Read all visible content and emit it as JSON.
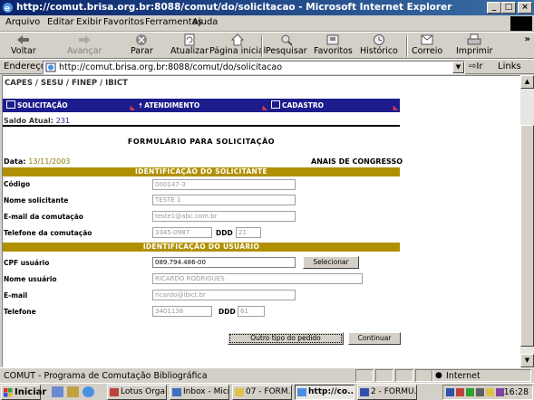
{
  "window": {
    "title": "http://comut.brisa.org.br:8088/comut/do/solicitacao - Microsoft Internet Explorer",
    "controls": [
      "_",
      "□",
      "×"
    ]
  },
  "menu": [
    "Arquivo",
    "Editar",
    "Exibir",
    "Favoritos",
    "Ferramentas",
    "Ajuda"
  ],
  "toolbar": {
    "back": "Voltar",
    "forward": "Avançar",
    "stop": "Parar",
    "refresh": "Atualizar",
    "home": "Página inicial",
    "search": "Pesquisar",
    "favorites": "Favoritos",
    "history": "Histórico",
    "mail": "Correio",
    "print": "Imprimir",
    "more": "»"
  },
  "address": {
    "label": "Endereço",
    "url": "http://comut.brisa.org.br:8088/comut/do/solicitacao",
    "go": "Ir",
    "links": "Links"
  },
  "page": {
    "header": "CAPES / SESU / FINEP / IBICT",
    "nav": [
      "SOLICITAÇÃO",
      "ATENDIMENTO",
      "CADASTRO"
    ],
    "saldo_label": "Saldo Atual:",
    "saldo_value": "231",
    "form_title": "FORMULÁRIO PARA SOLICITAÇÃO",
    "data_label": "Data:",
    "data_value": "13/11/2003",
    "doc_type": "ANAIS DE CONGRESSO",
    "section_requester": "IDENTIFICAÇÃO DO SOLICITANTE",
    "section_user": "IDENTIFICAÇÃO DO USUÁRIO",
    "fields": {
      "codigo_label": "Código",
      "codigo_value": "000147-3",
      "nome_sol_label": "Nome solicitante",
      "nome_sol_value": "TESTE 1",
      "email_com_label": "E-mail da comutação",
      "email_com_value": "teste1@abc.com.br",
      "tel_com_label": "Telefone da comutação",
      "tel_com_value": "3345-0987",
      "ddd_label": "DDD",
      "ddd_com_value": "21",
      "cpf_label": "CPF usuário",
      "cpf_value": "089.794.486-00",
      "nome_user_label": "Nome usuário",
      "nome_user_value": "RICARDO RODRIGUES",
      "email_label": "E-mail",
      "email_value": "ricardo@ibict.br",
      "tel_label": "Telefone",
      "tel_value": "3401138",
      "ddd_user_value": "61"
    },
    "buttons": {
      "selecionar": "Selecionar",
      "outro_tipo": "Outro tipo do pedido",
      "continuar": "Continuar"
    }
  },
  "status": {
    "text": "COMUT - Programa de Comutação Bibliográfica",
    "zone": "Internet"
  },
  "taskbar": {
    "start": "Iniciar",
    "tasks": [
      "Lotus Orga...",
      "Inbox - Micr...",
      "07 - FORM...",
      "http://co...",
      "2 - FORMU..."
    ],
    "clock": "16:28"
  },
  "colors": {
    "nav_bg": "#1c1c8c",
    "section_bg": "#b09000",
    "title_bar": "#0a246a"
  }
}
